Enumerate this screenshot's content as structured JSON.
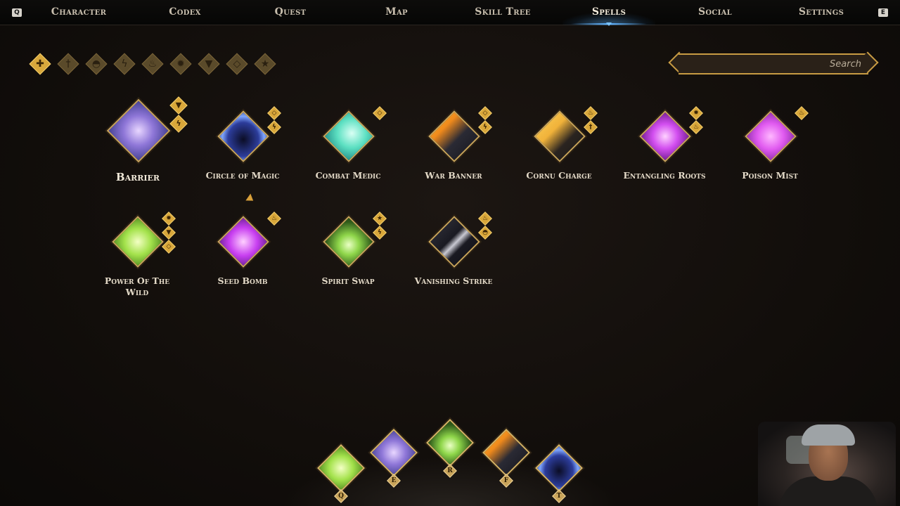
{
  "nav": {
    "left_key": "Q",
    "right_key": "E",
    "tabs": [
      "Character",
      "Codex",
      "Quest",
      "Map",
      "Skill Tree",
      "Spells",
      "Social",
      "Settings"
    ],
    "active": "Spells"
  },
  "filters": [
    {
      "icon": "all-grid-icon",
      "active": true
    },
    {
      "icon": "sword-icon",
      "active": false
    },
    {
      "icon": "helmet-icon",
      "active": false
    },
    {
      "icon": "lightning-icon",
      "active": false
    },
    {
      "icon": "fire-icon",
      "active": false
    },
    {
      "icon": "sun-icon",
      "active": false
    },
    {
      "icon": "shield-icon",
      "active": false
    },
    {
      "icon": "gem-icon",
      "active": false
    },
    {
      "icon": "star-icon",
      "active": false
    }
  ],
  "search": {
    "placeholder": "Search"
  },
  "spells": [
    {
      "name": "Barrier",
      "selected": true,
      "tags": [
        "shield",
        "lightning"
      ]
    },
    {
      "name": "Circle of Magic",
      "tags": [
        "gem",
        "lightning"
      ]
    },
    {
      "name": "Combat Medic",
      "tags": [
        "gem"
      ]
    },
    {
      "name": "War Banner",
      "tags": [
        "gem",
        "lightning"
      ]
    },
    {
      "name": "Cornu Charge",
      "tags": [
        "fire",
        "sword"
      ]
    },
    {
      "name": "Entangling Roots",
      "tags": [
        "sun",
        "fire"
      ]
    },
    {
      "name": "Poison Mist",
      "tags": [
        "fire"
      ]
    },
    {
      "name": "Power Of The Wild",
      "tags": [
        "sun",
        "shield",
        "gem"
      ]
    },
    {
      "name": "Seed Bomb",
      "tags": [
        "fire"
      ]
    },
    {
      "name": "Spirit Swap",
      "tags": [
        "star",
        "lightning"
      ]
    },
    {
      "name": "Vanishing Strike",
      "tags": [
        "fire",
        "helmet"
      ]
    }
  ],
  "hotbar": [
    {
      "spell": "Power Of The Wild",
      "key": "Q"
    },
    {
      "spell": "Barrier",
      "key": "E"
    },
    {
      "spell": "Spirit Swap",
      "key": "R"
    },
    {
      "spell": "War Banner",
      "key": "F"
    },
    {
      "spell": "Circle of Magic",
      "key": "T"
    }
  ],
  "colors": {
    "accent_gold": "#d9a73a",
    "active_tab_glow": "#5fb3ff",
    "background": "#120e0b"
  }
}
